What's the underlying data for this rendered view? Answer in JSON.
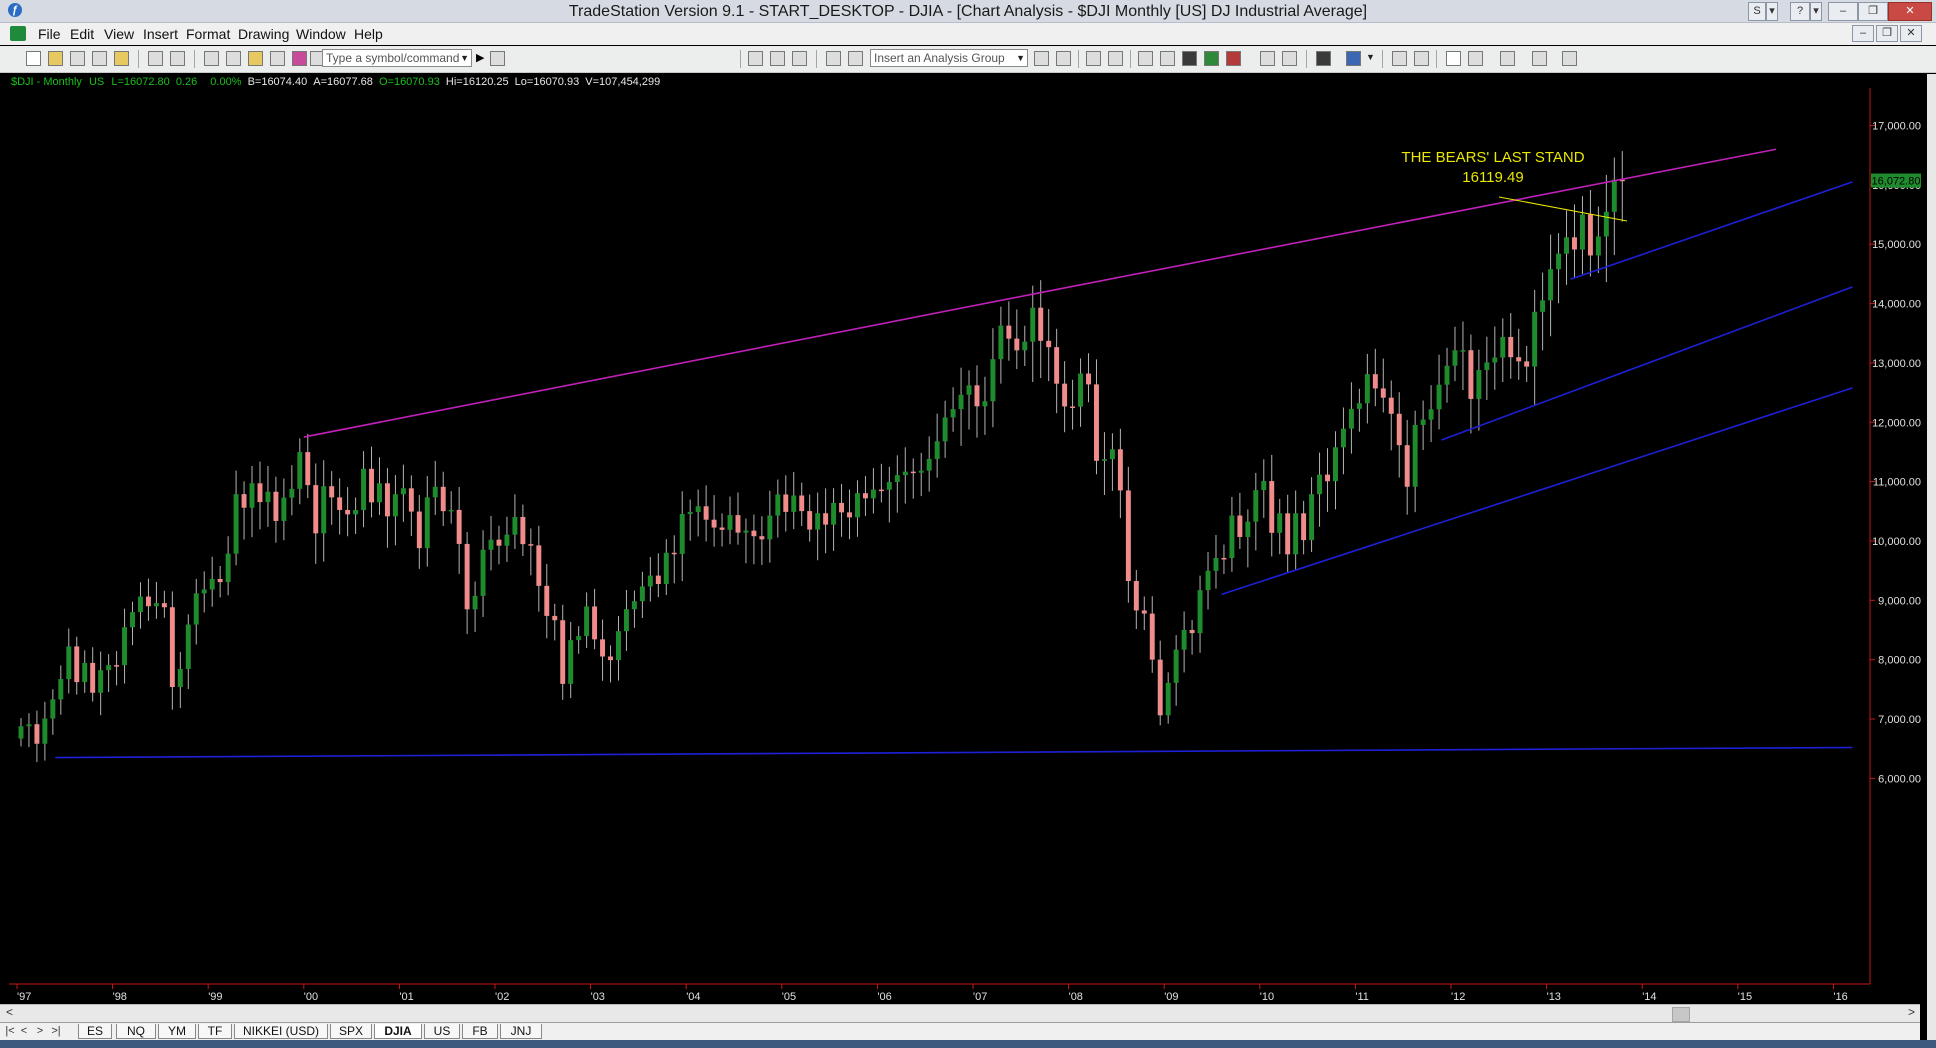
{
  "window": {
    "title": "TradeStation Version 9.1 - START_DESKTOP - DJIA - [Chart Analysis - $DJI Monthly [US] DJ Industrial Average]",
    "s_button": "S"
  },
  "menu": {
    "items": [
      "File",
      "Edit",
      "View",
      "Insert",
      "Format",
      "Drawing",
      "Window",
      "Help"
    ]
  },
  "toolbar": {
    "symbol_placeholder": "Type a symbol/command",
    "analysis_group_placeholder": "Insert an Analysis Group"
  },
  "status": {
    "symbol": "$DJI - Monthly",
    "exchange": "US",
    "last": "L=16072.80",
    "net_change": "0.26",
    "pct_change": "0.00%",
    "bid": "B=16074.40",
    "ask": "A=16077.68",
    "open": "O=16070.93",
    "high": "Hi=16120.25",
    "low": "Lo=16070.93",
    "volume": "V=107,454,299",
    "colors": {
      "label": "#19c019",
      "values": "#e6e6e6",
      "open": "#19c019"
    }
  },
  "chart_data": {
    "type": "candlestick",
    "symbol": "$DJI",
    "interval": "Monthly",
    "x_tick_labels": [
      "'97",
      "'98",
      "'99",
      "'00",
      "'01",
      "'02",
      "'03",
      "'04",
      "'05",
      "'06",
      "'07",
      "'08",
      "'09",
      "'10",
      "'11",
      "'12",
      "'13",
      "'14",
      "'15",
      "'16"
    ],
    "y_tick_labels": [
      "6,000.00",
      "7,000.00",
      "8,000.00",
      "9,000.00",
      "10,000.00",
      "11,000.00",
      "12,000.00",
      "13,000.00",
      "14,000.00",
      "15,000.00",
      "16,000.00",
      "17,000.00"
    ],
    "ylim": [
      5700,
      17600
    ],
    "xlim": [
      1997.0,
      2016.3
    ],
    "last_price_label": "16,072.80",
    "grid": false,
    "colors": {
      "up": "#1e8c2c",
      "down": "#f08c8c",
      "wick": "#b4b4b4",
      "background": "#000000",
      "trendline_main": "#c020b8",
      "trendline_channel": "#1e20d8",
      "annotation": "#e8e800"
    },
    "monthly_closes": [
      6877,
      6912,
      6583,
      7009,
      7331,
      7673,
      8223,
      7622,
      7945,
      7442,
      7823,
      7908,
      7907,
      8546,
      8800,
      9063,
      8900,
      8952,
      8883,
      7539,
      7843,
      8592,
      9117,
      9181,
      9359,
      9307,
      9786,
      10789,
      10560,
      10971,
      10655,
      10829,
      10337,
      10730,
      10878,
      11497,
      10941,
      10128,
      10922,
      10734,
      10522,
      10448,
      10522,
      11215,
      10651,
      10971,
      10415,
      10787,
      10887,
      10495,
      9879,
      10735,
      10912,
      10502,
      10523,
      9950,
      8848,
      9075,
      9852,
      10022,
      9920,
      10106,
      10404,
      9946,
      9925,
      9243,
      8737,
      8664,
      7592,
      8329,
      8397,
      8896,
      8342,
      8053,
      7992,
      8480,
      8850,
      8985,
      9234,
      9416,
      9275,
      9801,
      9782,
      10454,
      10488,
      10584,
      10358,
      10226,
      10188,
      10435,
      10140,
      10174,
      10080,
      10027,
      10428,
      10783,
      10490,
      10766,
      10503,
      10192,
      10467,
      10275,
      10641,
      10482,
      10398,
      10805,
      10718,
      10865,
      10864,
      10993,
      11109,
      11168,
      11150,
      11185,
      11382,
      11679,
      12081,
      12222,
      12463,
      12622,
      12269,
      12354,
      13063,
      13628,
      13409,
      13212,
      13358,
      13930,
      13372,
      13265,
      12650,
      12266,
      12263,
      12820,
      12638,
      11350,
      11378,
      11544,
      10851,
      9325,
      8829,
      8776,
      8000,
      7062,
      7609,
      8168,
      8500,
      8447,
      9171,
      9496,
      9713,
      9712,
      10428,
      10067,
      10325,
      10857,
      11009,
      10137,
      10465,
      9774,
      10466,
      10014,
      10788,
      11118,
      11006,
      11578,
      11892,
      12226,
      12320,
      12810,
      12570,
      12414,
      12143,
      11614,
      10913,
      11955,
      12045,
      12218,
      12632,
      12952,
      13212,
      13214,
      12393,
      12880,
      13008,
      13090,
      13437,
      13096,
      13026,
      12938,
      13861,
      14054,
      14579,
      14840,
      15116,
      14910,
      15500,
      14810,
      15130,
      15546,
      16086,
      16072
    ],
    "months_start": "1997-01",
    "annotation": {
      "line1": "THE BEARS' LAST STAND",
      "line2": "16119.49"
    },
    "trendlines": [
      {
        "name": "resistance",
        "color": "purple",
        "points": [
          [
            2000.0,
            11750
          ],
          [
            2007.75,
            14198
          ],
          [
            2015.4,
            16600
          ]
        ]
      },
      {
        "name": "support-long",
        "color": "blue",
        "points": [
          [
            1997.4,
            6350
          ],
          [
            2016.2,
            6520
          ]
        ]
      },
      {
        "name": "channel-1",
        "color": "blue",
        "points": [
          [
            2009.6,
            9100
          ],
          [
            2016.2,
            12580
          ]
        ]
      },
      {
        "name": "channel-2",
        "color": "blue",
        "points": [
          [
            2011.9,
            11700
          ],
          [
            2016.2,
            14280
          ]
        ]
      },
      {
        "name": "channel-3",
        "color": "blue",
        "points": [
          [
            2013.25,
            14410
          ],
          [
            2016.2,
            16050
          ]
        ]
      }
    ]
  },
  "tabs": {
    "items": [
      "ES",
      "NQ",
      "YM",
      "TF",
      "NIKKEI (USD)",
      "SPX",
      "DJIA",
      "US",
      "FB",
      "JNJ"
    ],
    "active": "DJIA"
  }
}
